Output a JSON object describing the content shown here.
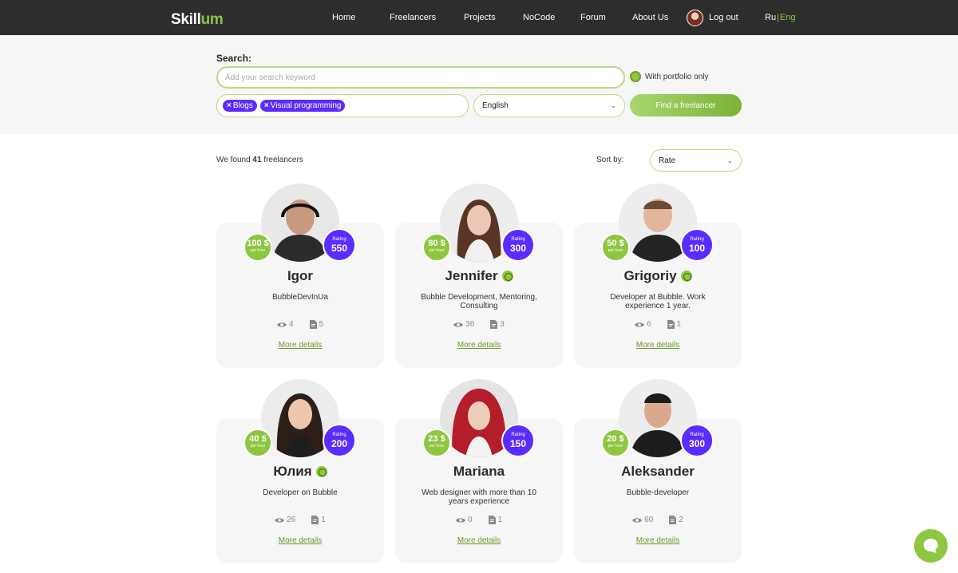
{
  "header": {
    "logo_main": "Skill",
    "logo_accent": "um",
    "nav": [
      "Home",
      "Freelancers",
      "Projects",
      "NoCode",
      "Forum",
      "About Us"
    ],
    "logout": "Log out",
    "lang_ru": "Ru",
    "lang_sep": "|",
    "lang_en": "Eng"
  },
  "search": {
    "label": "Search:",
    "placeholder": "Add your search keyword",
    "portfolio_label": "With portfolio only",
    "tags": [
      "Blogs",
      "Visual programming"
    ],
    "tag_remove_glyph": "×",
    "language": "English",
    "find_button": "Find a freelancer"
  },
  "results": {
    "found_prefix": "We found",
    "found_count": "41",
    "found_suffix": "freelancers",
    "sort_label": "Sort by:",
    "sort_value": "Rate"
  },
  "cards": [
    {
      "name": "Igor",
      "desc": "BubbleDevInUa",
      "rate": "100 $",
      "per": "per hour",
      "rating_label": "Rating",
      "rating": "550",
      "views": "4",
      "docs": "5",
      "more": "More details",
      "verified": false
    },
    {
      "name": "Jennifer",
      "desc": "Bubble Development, Mentoring, Consulting",
      "rate": "80 $",
      "per": "per hour",
      "rating_label": "Rating",
      "rating": "300",
      "views": "36",
      "docs": "3",
      "more": "More details",
      "verified": true
    },
    {
      "name": "Grigoriy",
      "desc": "Developer at Bubble. Work experience 1 year.",
      "rate": "50 $",
      "per": "per hour",
      "rating_label": "Rating",
      "rating": "100",
      "views": "6",
      "docs": "1",
      "more": "More details",
      "verified": true
    },
    {
      "name": "Юлия",
      "desc": "Developer on Bubble",
      "rate": "40 $",
      "per": "per hour",
      "rating_label": "Rating",
      "rating": "200",
      "views": "26",
      "docs": "1",
      "more": "More details",
      "verified": true
    },
    {
      "name": "Mariana",
      "desc": "Web designer with more than 10 years experience",
      "rate": "23 $",
      "per": "per hour",
      "rating_label": "Rating",
      "rating": "150",
      "views": "0",
      "docs": "1",
      "more": "More details",
      "verified": false
    },
    {
      "name": "Aleksander",
      "desc": "Bubble-developer",
      "rate": "20 $",
      "per": "per hour",
      "rating_label": "Rating",
      "rating": "300",
      "views": "60",
      "docs": "2",
      "more": "More details",
      "verified": false
    }
  ],
  "colors": {
    "accent_green": "#8dc63f",
    "accent_purple": "#5b2cff",
    "header_bg": "#2d2d2d"
  }
}
